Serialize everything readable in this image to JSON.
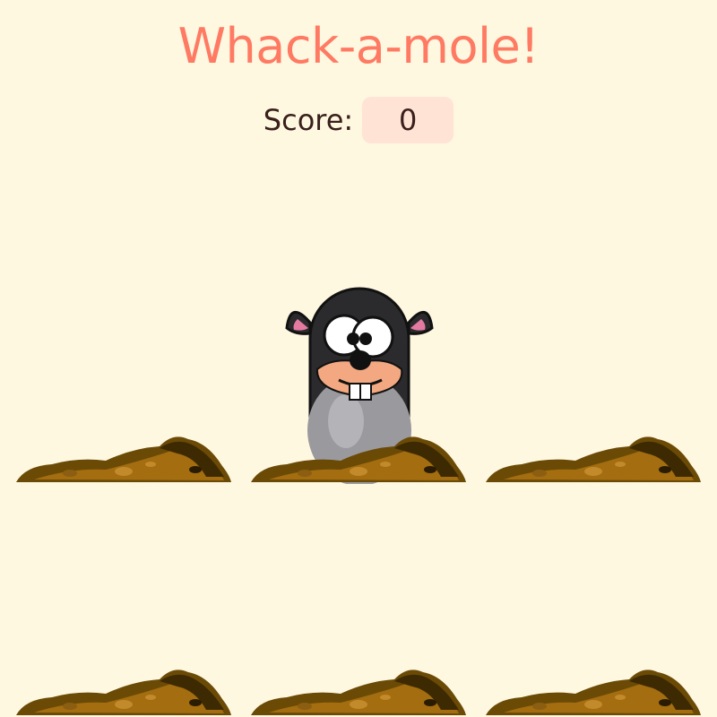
{
  "game": {
    "title": "Whack-a-mole!",
    "score_label": "Score:",
    "score_value": "0",
    "title_color": "#ff7a63",
    "score_box_color": "#ffe3d4",
    "background_color": "#fff8e1"
  },
  "holes": [
    {
      "id": 1,
      "mole_visible": false
    },
    {
      "id": 2,
      "mole_visible": true
    },
    {
      "id": 3,
      "mole_visible": false
    },
    {
      "id": 4,
      "mole_visible": false
    },
    {
      "id": 5,
      "mole_visible": false
    },
    {
      "id": 6,
      "mole_visible": false
    }
  ]
}
